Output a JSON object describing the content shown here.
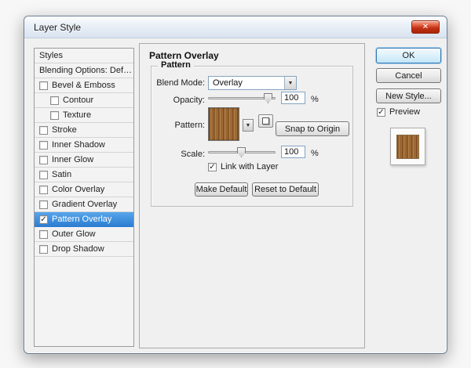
{
  "window": {
    "title": "Layer Style"
  },
  "icons": {
    "close": "✕",
    "check": "✓",
    "dropdown_arrow": "▼"
  },
  "sidebar": {
    "rows": [
      {
        "label": "Styles",
        "type": "plain"
      },
      {
        "label": "Blending Options: Default",
        "type": "plain"
      },
      {
        "label": "Bevel & Emboss",
        "type": "check",
        "checked": false,
        "indent": false,
        "selected": false
      },
      {
        "label": "Contour",
        "type": "check",
        "checked": false,
        "indent": true,
        "selected": false
      },
      {
        "label": "Texture",
        "type": "check",
        "checked": false,
        "indent": true,
        "selected": false
      },
      {
        "label": "Stroke",
        "type": "check",
        "checked": false,
        "indent": false,
        "selected": false
      },
      {
        "label": "Inner Shadow",
        "type": "check",
        "checked": false,
        "indent": false,
        "selected": false
      },
      {
        "label": "Inner Glow",
        "type": "check",
        "checked": false,
        "indent": false,
        "selected": false
      },
      {
        "label": "Satin",
        "type": "check",
        "checked": false,
        "indent": false,
        "selected": false
      },
      {
        "label": "Color Overlay",
        "type": "check",
        "checked": false,
        "indent": false,
        "selected": false
      },
      {
        "label": "Gradient Overlay",
        "type": "check",
        "checked": false,
        "indent": false,
        "selected": false
      },
      {
        "label": "Pattern Overlay",
        "type": "check",
        "checked": true,
        "indent": false,
        "selected": true
      },
      {
        "label": "Outer Glow",
        "type": "check",
        "checked": false,
        "indent": false,
        "selected": false
      },
      {
        "label": "Drop Shadow",
        "type": "check",
        "checked": false,
        "indent": false,
        "selected": false
      }
    ]
  },
  "main": {
    "title": "Pattern Overlay",
    "group_title": "Pattern",
    "blend_mode_label": "Blend Mode:",
    "blend_mode_value": "Overlay",
    "opacity_label": "Opacity:",
    "opacity_value": "100",
    "opacity_unit": "%",
    "pattern_label": "Pattern:",
    "snap_button_label": "Snap to Origin",
    "scale_label": "Scale:",
    "scale_value": "100",
    "scale_unit": "%",
    "link_with_layer_label": "Link with Layer",
    "link_with_layer_checked": true,
    "make_default_label": "Make Default",
    "reset_default_label": "Reset to Default"
  },
  "actions": {
    "ok": "OK",
    "cancel": "Cancel",
    "new_style": "New Style...",
    "preview_label": "Preview",
    "preview_checked": true
  },
  "colors": {
    "selection": "#3d90e4",
    "wood_base": "#a26d38"
  }
}
